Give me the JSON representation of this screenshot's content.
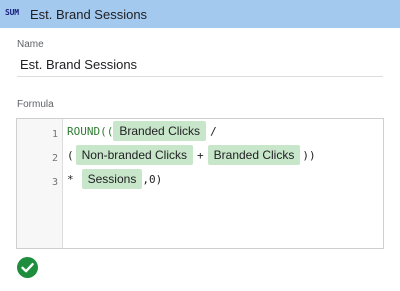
{
  "header": {
    "aggregation_badge": "SUM",
    "title": "Est. Brand Sessions"
  },
  "name_field": {
    "label": "Name",
    "value": "Est. Brand Sessions"
  },
  "formula": {
    "label": "Formula",
    "line_numbers": [
      "1",
      "2",
      "3"
    ],
    "line1": {
      "prefix": "ROUND((",
      "chip": "Branded Clicks",
      "suffix": "/"
    },
    "line2": {
      "prefix": "(",
      "chip1": "Non-branded Clicks",
      "operator": "+",
      "chip2": "Branded Clicks",
      "suffix": "))"
    },
    "line3": {
      "prefix": "*",
      "chip": "Sessions",
      "suffix": ",0)"
    }
  },
  "status": {
    "icon": "check-circle-icon",
    "color": "#1e8e3e"
  }
}
